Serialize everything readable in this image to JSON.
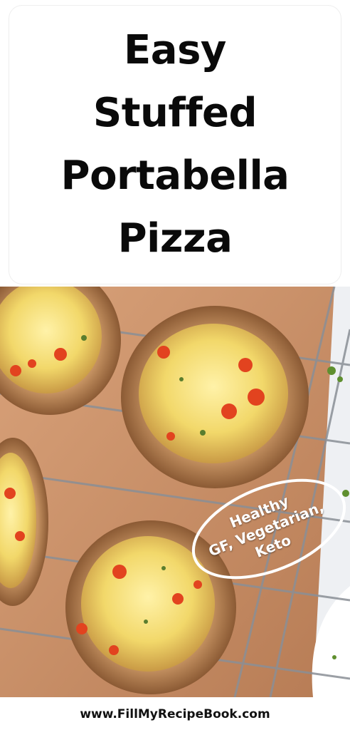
{
  "title": {
    "lines": [
      "Easy",
      "Stuffed",
      "Portabella",
      "Pizza"
    ]
  },
  "badge": {
    "lines": [
      "Healthy",
      "GF, Vegetarian,",
      "Keto"
    ]
  },
  "footer": {
    "url": "www.FillMyRecipeBook.com"
  },
  "colors": {
    "title_text": "#0a0a0a",
    "parchment": "#c9906a",
    "mushroom": "#a9744a",
    "cheese": "#f2d86a",
    "pepper": "#e2431f",
    "rack": "#8a8f96"
  }
}
